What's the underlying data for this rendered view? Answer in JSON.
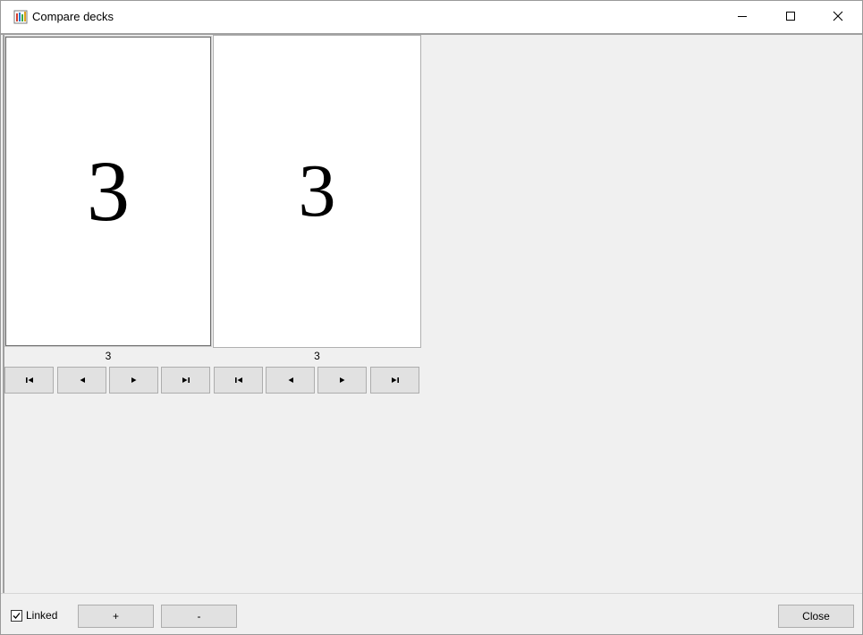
{
  "window": {
    "title": "Compare decks",
    "icon": "deck-app-icon"
  },
  "controls": {
    "minimize_icon": "minimize-icon",
    "maximize_icon": "maximize-icon",
    "close_icon": "close-icon"
  },
  "left_deck": {
    "card_value": "3",
    "count": "3"
  },
  "right_deck": {
    "card_value": "3",
    "count": "3"
  },
  "nav": {
    "first_icon": "first-icon",
    "prev_icon": "previous-icon",
    "next_icon": "next-icon",
    "last_icon": "last-icon"
  },
  "bottom": {
    "linked_label": "Linked",
    "linked_checked": true,
    "plus_label": "+",
    "minus_label": "-",
    "close_label": "Close"
  },
  "colors": {
    "window_bg": "#f0f0f0",
    "button_bg": "#e1e1e1",
    "button_border": "#adadad"
  }
}
